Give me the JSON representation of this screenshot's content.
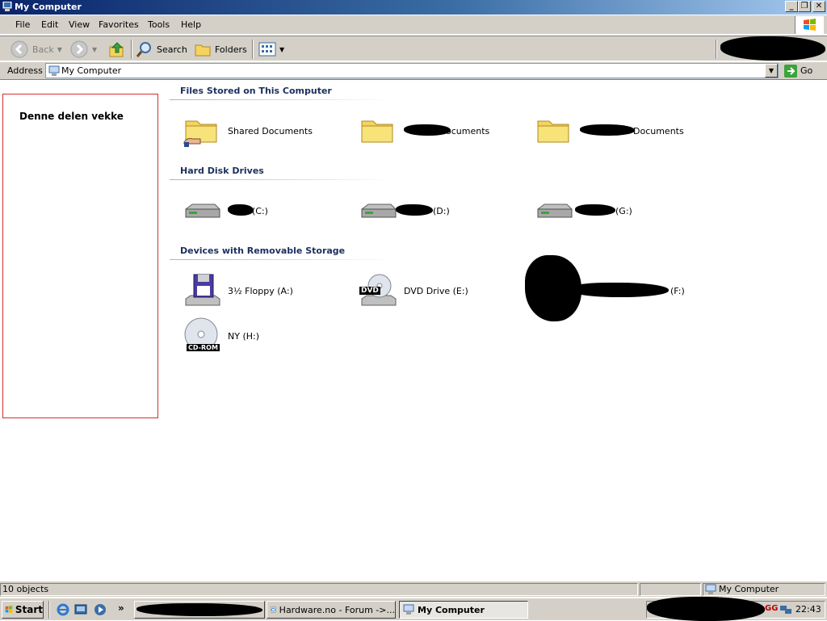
{
  "window": {
    "title": "My Computer"
  },
  "menu": [
    "File",
    "Edit",
    "View",
    "Favorites",
    "Tools",
    "Help"
  ],
  "toolbar": {
    "back": "Back",
    "search": "Search",
    "folders": "Folders"
  },
  "address": {
    "label": "Address",
    "value": "My Computer",
    "go": "Go"
  },
  "annotation": "Denne delen vekke",
  "sections": {
    "files": {
      "title": "Files Stored on This Computer",
      "items": [
        "Shared Documents",
        "ocuments",
        "Documents"
      ]
    },
    "drives": {
      "title": "Hard Disk Drives",
      "items": [
        "(C:)",
        "(D:)",
        "(G:)"
      ]
    },
    "removable": {
      "title": "Devices with Removable Storage",
      "items": [
        "3½ Floppy (A:)",
        "DVD Drive (E:)",
        "(F:)",
        "NY (H:)"
      ],
      "dvd_badge": "DVD",
      "cd_badge": "CD-ROM"
    }
  },
  "status": {
    "count": "10 objects",
    "location": "My Computer"
  },
  "taskbar": {
    "start": "Start",
    "tasks": [
      "Hardware.no - Forum ->...",
      "My Computer"
    ],
    "clock": "22:43",
    "tray_label": "GG"
  },
  "colors": {
    "title_start": "#0a246a",
    "title_end": "#a6caf0",
    "face": "#d4d0c8",
    "section_text": "#1c2f5e"
  }
}
